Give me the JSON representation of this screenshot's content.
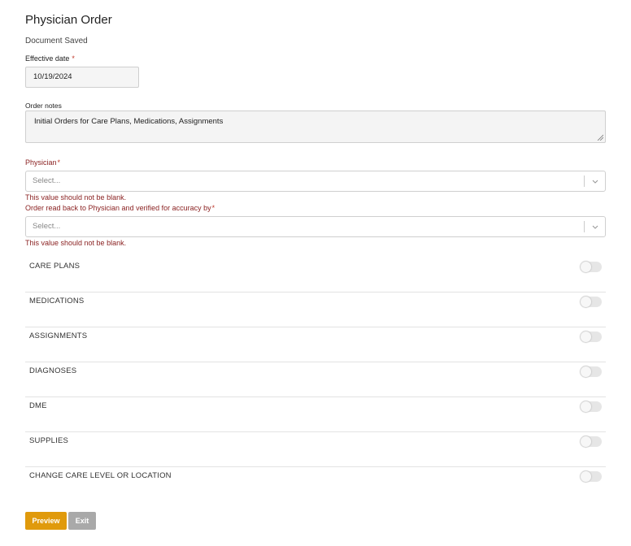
{
  "page": {
    "title": "Physician Order",
    "status": "Document Saved"
  },
  "effective_date": {
    "label": "Effective date",
    "required_mark": "*",
    "value": "10/19/2024"
  },
  "order_notes": {
    "label": "Order notes",
    "value": "Initial Orders for Care Plans, Medications, Assignments"
  },
  "physician": {
    "label": "Physician",
    "required_mark": "*",
    "placeholder": "Select...",
    "error": "This value should not be blank."
  },
  "verified_by": {
    "label": "Order read back to Physician and verified for accuracy by",
    "required_mark": "*",
    "placeholder": "Select...",
    "error": "This value should not be blank."
  },
  "sections": [
    {
      "label": "CARE PLANS",
      "enabled": false
    },
    {
      "label": "MEDICATIONS",
      "enabled": false
    },
    {
      "label": "ASSIGNMENTS",
      "enabled": false
    },
    {
      "label": "DIAGNOSES",
      "enabled": false
    },
    {
      "label": "DME",
      "enabled": false
    },
    {
      "label": "SUPPLIES",
      "enabled": false
    },
    {
      "label": "CHANGE CARE LEVEL OR LOCATION",
      "enabled": false
    }
  ],
  "buttons": {
    "preview": "Preview",
    "exit": "Exit"
  },
  "colors": {
    "primary_button": "#e09a0c",
    "secondary_button": "#a9a9a9",
    "error_text": "#8b2323",
    "required_mark": "#c0392b"
  },
  "icons": {
    "select_caret": "chevron-down-icon",
    "textarea_resize": "resize-handle-icon"
  }
}
